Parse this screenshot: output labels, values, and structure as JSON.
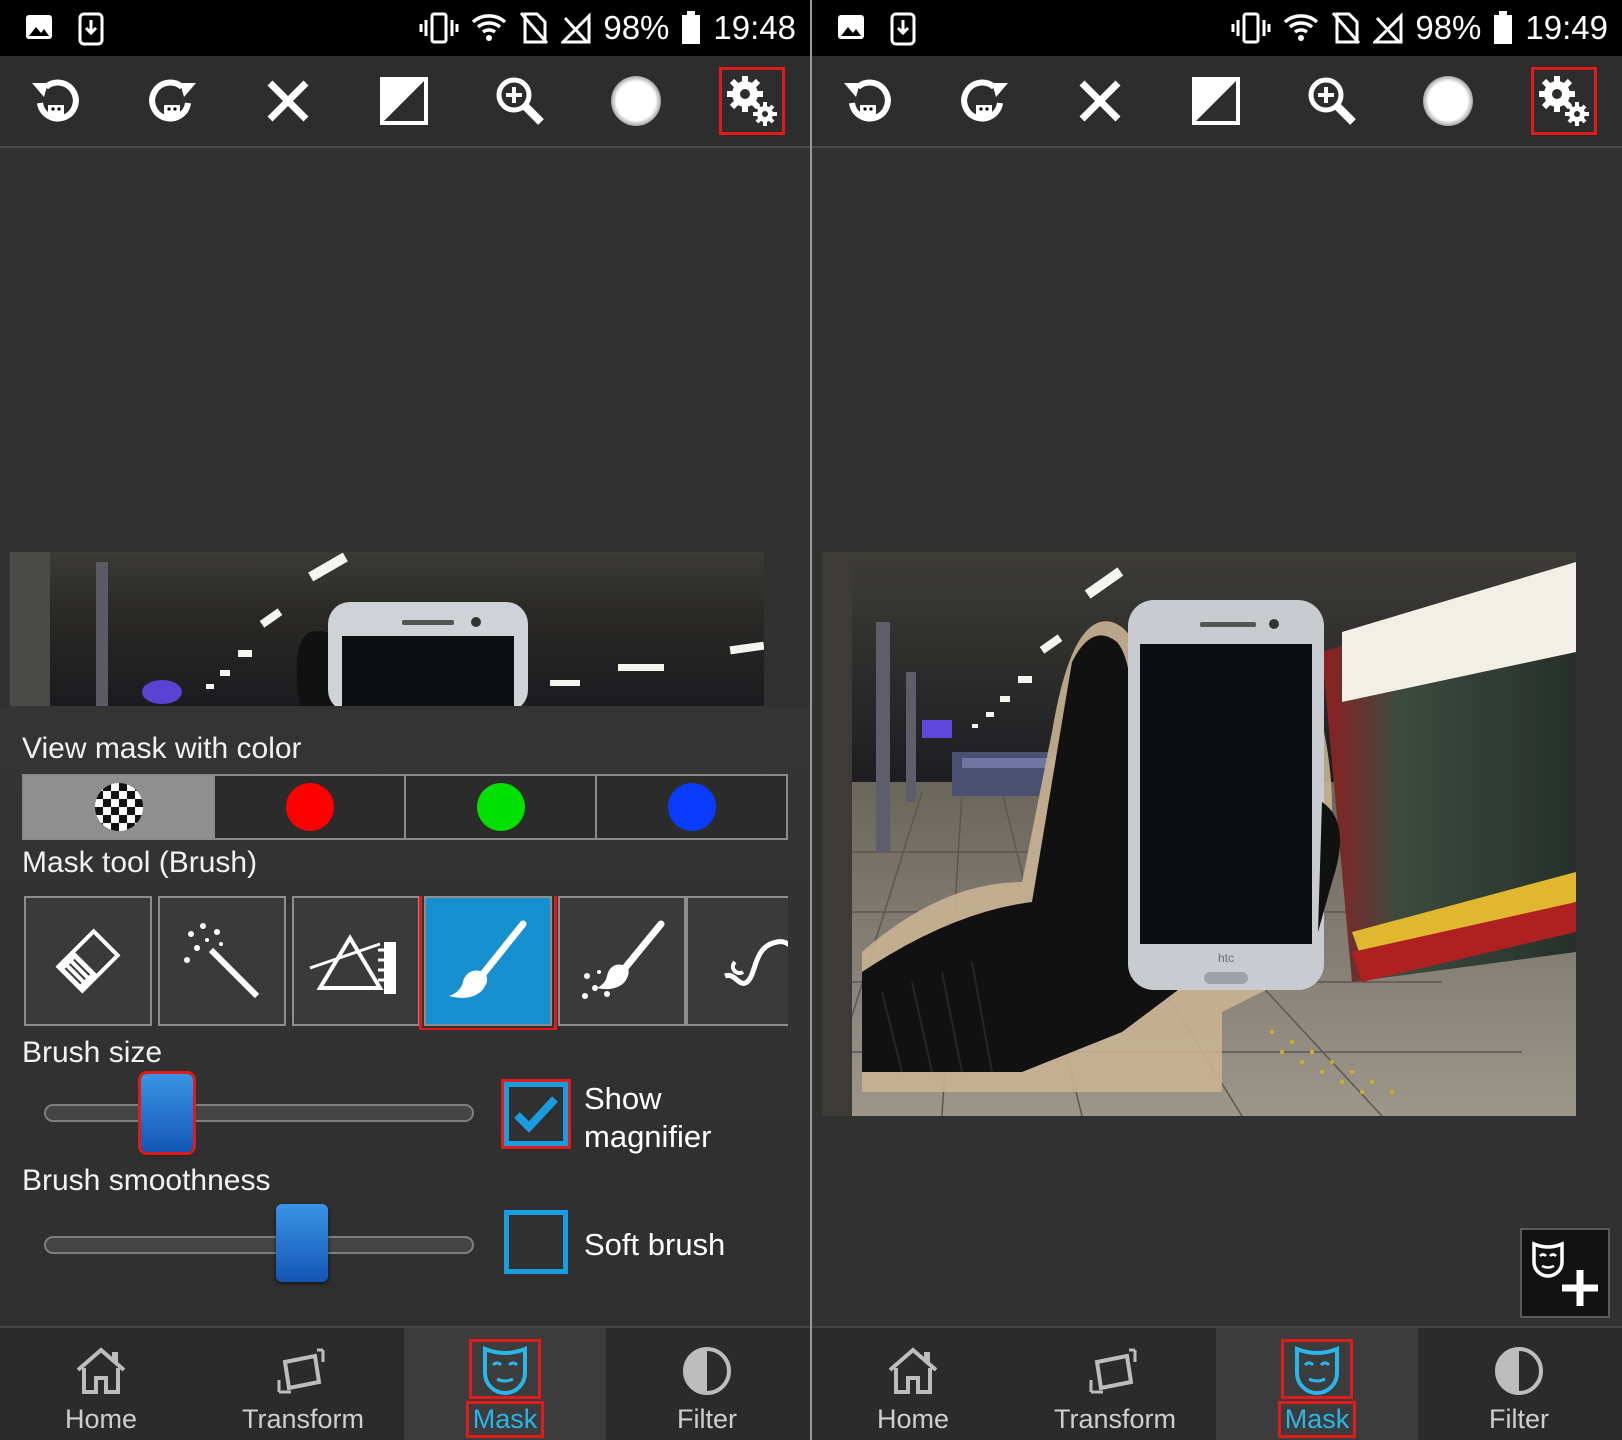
{
  "screens": [
    {
      "id": "left",
      "status": {
        "battery": "98%",
        "time": "19:48"
      },
      "toolbar": {
        "items": [
          "undo-mask-icon",
          "redo-mask-icon",
          "clear-icon",
          "invert-icon",
          "zoom-icon",
          "brush-preview-icon",
          "settings-icon"
        ],
        "highlighted": "settings-icon"
      },
      "settings_panel": {
        "view_mask_label": "View mask with color",
        "mask_colors": [
          {
            "name": "checker",
            "color": "checker",
            "selected": true
          },
          {
            "name": "red",
            "color": "#ff0000",
            "selected": false
          },
          {
            "name": "green",
            "color": "#00e000",
            "selected": false
          },
          {
            "name": "blue",
            "color": "#0a3cff",
            "selected": false
          }
        ],
        "mask_tool_label": "Mask tool (Brush)",
        "tools": [
          "eraser-icon",
          "magic-wand-icon",
          "gradient-icon",
          "brush-icon",
          "magic-brush-icon",
          "lasso-icon"
        ],
        "active_tool": "brush-icon",
        "brush_size_label": "Brush size",
        "brush_size_value": 0.26,
        "brush_smoothness_label": "Brush smoothness",
        "brush_smoothness_value": 0.62,
        "show_magnifier": {
          "line1": "Show",
          "line2": "magnifier",
          "checked": true
        },
        "soft_brush": {
          "label": "Soft brush",
          "checked": false
        }
      },
      "bottom_nav": [
        "Home",
        "Transform",
        "Mask",
        "Filter"
      ],
      "active_nav": "Mask"
    },
    {
      "id": "right",
      "status": {
        "battery": "98%",
        "time": "19:49"
      },
      "toolbar": {
        "items": [
          "undo-mask-icon",
          "redo-mask-icon",
          "clear-icon",
          "invert-icon",
          "zoom-icon",
          "brush-preview-icon",
          "settings-icon"
        ],
        "highlighted": "settings-icon"
      },
      "phone_brand_text": "htc",
      "bottom_nav": [
        "Home",
        "Transform",
        "Mask",
        "Filter"
      ],
      "active_nav": "Mask",
      "fab": "add-mask-icon"
    }
  ],
  "colors": {
    "accent": "#1a9ce0",
    "highlight": "#e01b1b",
    "active_tool": "#1690cf",
    "nav_active_text": "#2ab6ea"
  }
}
